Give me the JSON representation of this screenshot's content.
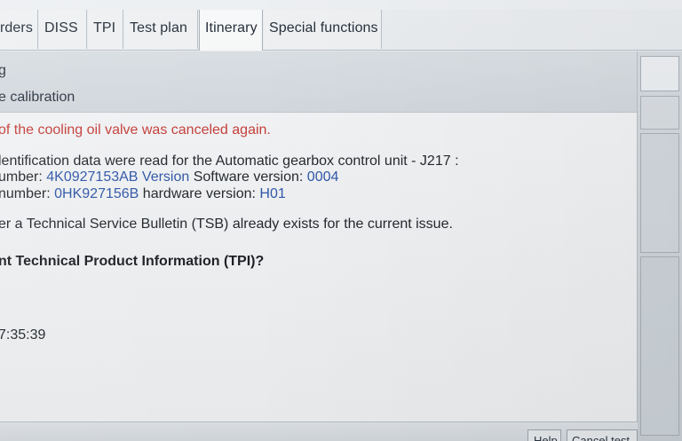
{
  "tabs": [
    {
      "label": "rders"
    },
    {
      "label": "DISS"
    },
    {
      "label": "TPI"
    },
    {
      "label": "Test plan"
    },
    {
      "label": "Itinerary"
    },
    {
      "label": "Special functions"
    }
  ],
  "header": {
    "line1": "g",
    "line2": "e calibration"
  },
  "content": {
    "warning": "of the cooling oil valve was canceled again.",
    "ident": "lentification data were read for the Automatic gearbox control unit - J217 :",
    "part_prefix": "umber: ",
    "part_number": "4K0927153AB",
    "part_version": "Version",
    "software_label": " Software version:",
    "software_version": "0004",
    "hardware_prefix": "number:",
    "hardware_number": "0HK927156B",
    "hardware_label": " hardware version:",
    "hardware_version": "H01",
    "tsb": "er a Technical Service Bulletin (TSB) already exists for the current issue.",
    "question": "nt Technical Product Information (TPI)?",
    "time": "7:35:39"
  },
  "buttons": {
    "help": "Help",
    "cancel": "Cancel test"
  }
}
